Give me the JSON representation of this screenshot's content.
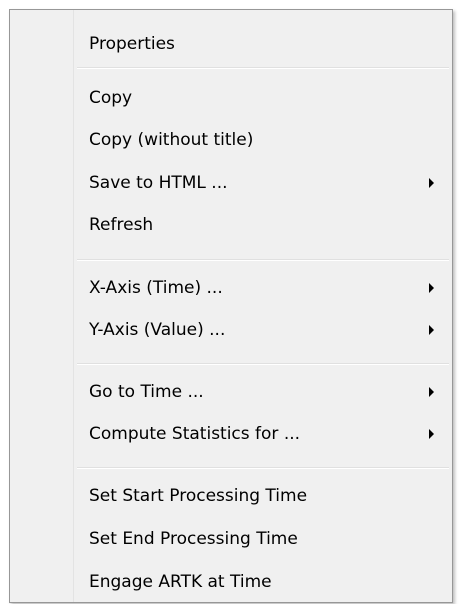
{
  "menu": {
    "items": [
      {
        "label": "Properties"
      },
      {
        "label": "Copy"
      },
      {
        "label": "Copy (without title)"
      },
      {
        "label": "Save to HTML ...",
        "submenu_icon": "submenu-arrow-icon"
      },
      {
        "label": "Refresh"
      },
      {
        "label": "X-Axis (Time) ...",
        "submenu_icon": "submenu-arrow-icon"
      },
      {
        "label": "Y-Axis (Value) ...",
        "submenu_icon": "submenu-arrow-icon"
      },
      {
        "label": "Go to Time ...",
        "submenu_icon": "submenu-arrow-icon"
      },
      {
        "label": "Compute Statistics for ...",
        "submenu_icon": "submenu-arrow-icon"
      },
      {
        "label": "Set Start Processing Time"
      },
      {
        "label": "Set End Processing Time"
      },
      {
        "label": "Engage ARTK at Time"
      }
    ]
  },
  "colors": {
    "menu_background": "#f0f0f0",
    "menu_border": "#979797",
    "text": "#000000",
    "separator": "#e0e0e0"
  }
}
